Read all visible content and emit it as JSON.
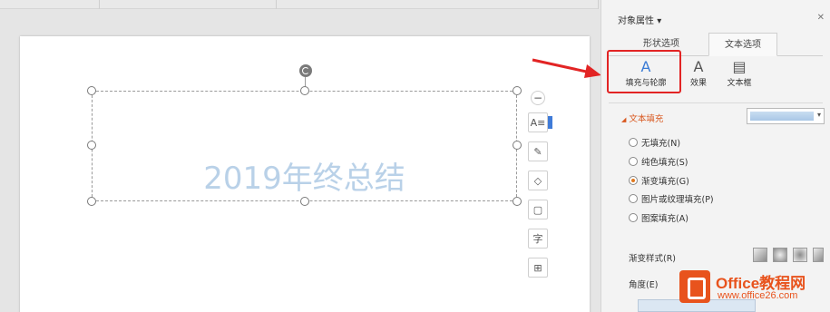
{
  "document": {
    "wordart_text": "2019年终总结"
  },
  "panel": {
    "title": "对象属性",
    "title_arrow": "▾",
    "close_glyph": "✕",
    "tabs": [
      {
        "label": "形状选项",
        "active": false
      },
      {
        "label": "文本选项",
        "active": true
      }
    ],
    "subtabs": [
      {
        "label": "填充与轮廓",
        "icon": "text-fill-outline-icon",
        "glyph": "A",
        "active": true
      },
      {
        "label": "效果",
        "icon": "text-effect-icon",
        "glyph": "A",
        "active": false
      },
      {
        "label": "文本框",
        "icon": "text-box-icon",
        "glyph": "▤",
        "active": false
      }
    ],
    "section": {
      "collapse_glyph": "◢",
      "title": "文本填充"
    },
    "fill_options": [
      {
        "label": "无填充(N)",
        "selected": false
      },
      {
        "label": "纯色填充(S)",
        "selected": false
      },
      {
        "label": "渐变填充(G)",
        "selected": true
      },
      {
        "label": "图片或纹理填充(P)",
        "selected": false
      },
      {
        "label": "图案填充(A)",
        "selected": false
      }
    ],
    "gradient_style_label": "渐变样式(R)",
    "angle_label": "角度(E)"
  },
  "floating_toolbar": [
    {
      "name": "collapse-toolbar-button",
      "glyph": "−"
    },
    {
      "name": "text-layout-button",
      "glyph": "A≡"
    },
    {
      "name": "shape-style-button",
      "glyph": "✎"
    },
    {
      "name": "fill-button",
      "glyph": "◇"
    },
    {
      "name": "outline-button",
      "glyph": "▢"
    },
    {
      "name": "font-button",
      "glyph": "字"
    },
    {
      "name": "more-options-button",
      "glyph": "⊞"
    }
  ],
  "watermark": {
    "brand": "Office教程网",
    "url": "www.office26.com"
  },
  "colors": {
    "accent": "#e55b2a",
    "highlight_box": "#e22424",
    "wordart_fill": "#b9d1e8",
    "radio_selected": "#e0781f"
  }
}
